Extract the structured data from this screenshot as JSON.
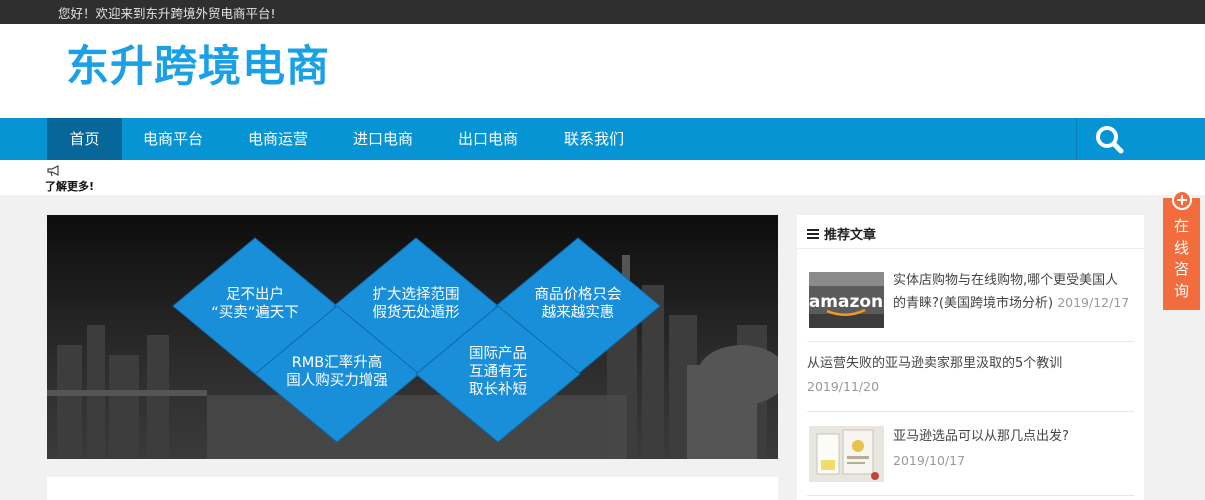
{
  "topbar": {
    "welcome": "您好！欢迎来到东升跨境外贸电商平台!"
  },
  "header": {
    "logo_text": "东升跨境电商"
  },
  "nav": {
    "items": [
      {
        "label": "首页",
        "active": true
      },
      {
        "label": "电商平台"
      },
      {
        "label": "电商运营"
      },
      {
        "label": "进口电商"
      },
      {
        "label": "出口电商"
      },
      {
        "label": "联系我们"
      }
    ],
    "search_icon": "search-icon"
  },
  "notice": {
    "icon": "megaphone-icon",
    "more": "了解更多!"
  },
  "banner": {
    "d1": [
      "足不出户",
      "“买卖”遍天下"
    ],
    "d2": [
      "扩大选择范围",
      "假货无处遁形"
    ],
    "d3": [
      "商品价格只会",
      "越来越实惠"
    ],
    "d4": [
      "RMB汇率升高",
      "国人购买力增强"
    ],
    "d5": [
      "国际产品",
      "互通有无",
      "取长补短"
    ]
  },
  "sidebar": {
    "title": "推荐文章",
    "articles": [
      {
        "title_line1": "实体店购物与在线购物,哪个更受美国人",
        "title_line2": "的青睐?(美国跨境市场分析)",
        "date": "2019/12/17",
        "thumb_text": "amazon"
      },
      {
        "title": "从运营失败的亚马逊卖家那里汲取的5个教训",
        "date": "2019/11/20"
      },
      {
        "title": "亚马逊选品可以从那几点出发?",
        "date": "2019/10/17"
      }
    ]
  },
  "consult": {
    "label": [
      "在",
      "线",
      "咨",
      "询"
    ]
  },
  "colors": {
    "nav": "#0694d4",
    "nav_active": "#07669a",
    "logo": "#1aa0e6",
    "consult": "#f36c3d",
    "diamond": "#1a8fd9"
  }
}
